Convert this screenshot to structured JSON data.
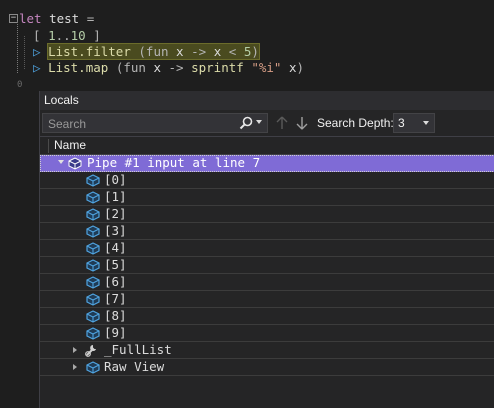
{
  "editor": {
    "collapse_glyph": "−",
    "line1": {
      "keyword": "let",
      "name": "test",
      "eq": "="
    },
    "line2": {
      "open": "[",
      "from": "1",
      "range": "..",
      "to": "10",
      "close": "]"
    },
    "line3": {
      "fn": "List.filter",
      "open": "(fun",
      "arg": "x",
      "arrow": "->",
      "x2": "x",
      "cmp": "<",
      "val": "5",
      "close": ")"
    },
    "line4": {
      "fn": "List.map",
      "open": "(fun",
      "arg": "x",
      "arrow": "->",
      "call": "sprintf",
      "fmt": "\"%i\"",
      "x2": "x",
      "close": ")"
    },
    "margin_mark": "0"
  },
  "locals": {
    "title": "Locals",
    "search": {
      "placeholder": "Search",
      "value": ""
    },
    "depth": {
      "label": "Search Depth:",
      "value": "3"
    },
    "column": "Name",
    "root": "Pipe #1 input at line 7",
    "items": [
      "[0]",
      "[1]",
      "[2]",
      "[3]",
      "[4]",
      "[5]",
      "[6]",
      "[7]",
      "[8]",
      "[9]"
    ],
    "extra": [
      "_FullList",
      "Raw View"
    ]
  },
  "colors": {
    "selection": "#7f6bd6",
    "highlight": "#4a4b1f",
    "icon_blue": "#4fa3e0"
  },
  "icons": {
    "root": "object-cube-icon",
    "item": "field-cube-icon",
    "fulllist": "wrench-property-icon",
    "rawview": "field-cube-icon"
  }
}
